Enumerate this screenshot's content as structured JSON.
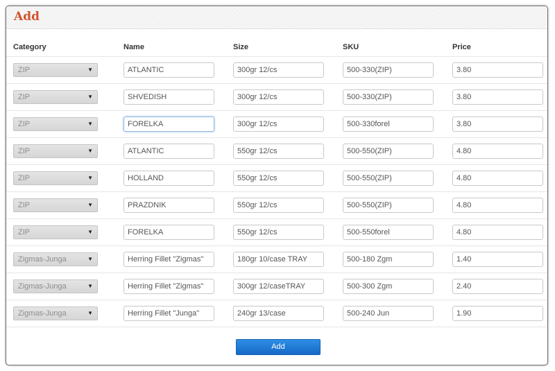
{
  "panel": {
    "title": "Add"
  },
  "columns": {
    "category": "Category",
    "name": "Name",
    "size": "Size",
    "sku": "SKU",
    "price": "Price"
  },
  "rows": [
    {
      "category": "ZIP",
      "name": "ATLANTIC",
      "size": "300gr 12/cs",
      "sku": "500-330(ZIP)",
      "price": "3.80"
    },
    {
      "category": "ZIP",
      "name": "SHVEDISH",
      "size": "300gr 12/cs",
      "sku": "500-330(ZIP)",
      "price": "3.80"
    },
    {
      "category": "ZIP",
      "name": "FORELKA",
      "size": "300gr 12/cs",
      "sku": "500-330forel",
      "price": "3.80"
    },
    {
      "category": "ZIP",
      "name": "ATLANTIC",
      "size": "550gr 12/cs",
      "sku": "500-550(ZIP)",
      "price": "4.80"
    },
    {
      "category": "ZIP",
      "name": "HOLLAND",
      "size": "550gr 12/cs",
      "sku": "500-550(ZIP)",
      "price": "4.80"
    },
    {
      "category": "ZIP",
      "name": "PRAZDNIK",
      "size": "550gr 12/cs",
      "sku": "500-550(ZIP)",
      "price": "4.80"
    },
    {
      "category": "ZIP",
      "name": "FORELKA",
      "size": "550gr 12/cs",
      "sku": "500-550forel",
      "price": "4.80"
    },
    {
      "category": "Zigmas-Junga",
      "name": "Herring Fillet \"Zigmas\"",
      "size": "180gr 10/case TRAY",
      "sku": "500-180 Zgm",
      "price": "1.40"
    },
    {
      "category": "Zigmas-Junga",
      "name": "Herring Fillet \"Zigmas\"",
      "size": "300gr 12/caseTRAY",
      "sku": "500-300 Zgm",
      "price": "2.40"
    },
    {
      "category": "Zigmas-Junga",
      "name": "Herring Fillet \"Junga\"",
      "size": "240gr 13/case",
      "sku": "500-240 Jun",
      "price": "1.90"
    }
  ],
  "focused_row": 2,
  "dropdown_arrow": "▼",
  "actions": {
    "add_label": "Add"
  },
  "colors": {
    "title": "#d2522a",
    "button": "#1e78d6",
    "focus": "#8fb8e0"
  }
}
